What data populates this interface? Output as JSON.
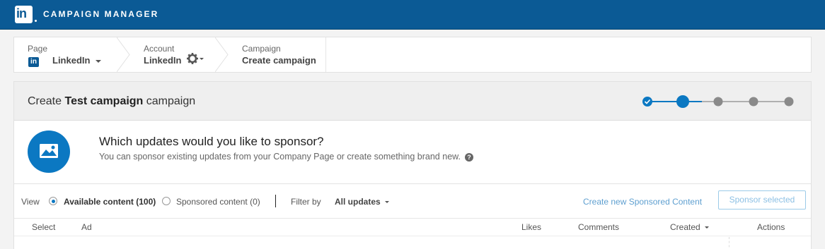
{
  "app": {
    "logo_text": "in",
    "title": "CAMPAIGN MANAGER"
  },
  "breadcrumb": {
    "page": {
      "key": "Page",
      "value": "LinkedIn"
    },
    "account": {
      "key": "Account",
      "value": "LinkedIn"
    },
    "campaign": {
      "key": "Campaign",
      "value": "Create campaign"
    }
  },
  "panel": {
    "title_prefix": "Create",
    "title_name": "Test campaign",
    "title_suffix": "campaign",
    "stepper": {
      "total_steps": 5,
      "completed_steps": 1,
      "current_step": 2
    }
  },
  "intro": {
    "heading": "Which updates would you like to sponsor?",
    "subtext": "You can sponsor existing updates from your Company Page or create something brand new.",
    "help_icon": "?"
  },
  "toolbar": {
    "view_label": "View",
    "available_label": "Available content (100)",
    "sponsored_label": "Sponsored content (0)",
    "selected_view": "available",
    "filter_label": "Filter by",
    "filter_value": "All updates",
    "create_link": "Create new Sponsored Content",
    "sponsor_button": "Sponsor selected"
  },
  "table": {
    "columns": [
      "Select",
      "Ad",
      "Likes",
      "Comments",
      "Created",
      "Actions"
    ],
    "sort_column": "Created"
  },
  "colors": {
    "brand": "#0b5a95",
    "accent": "#0b78c2",
    "link": "#5e9fd0",
    "step_inactive": "#8a8a8a"
  }
}
